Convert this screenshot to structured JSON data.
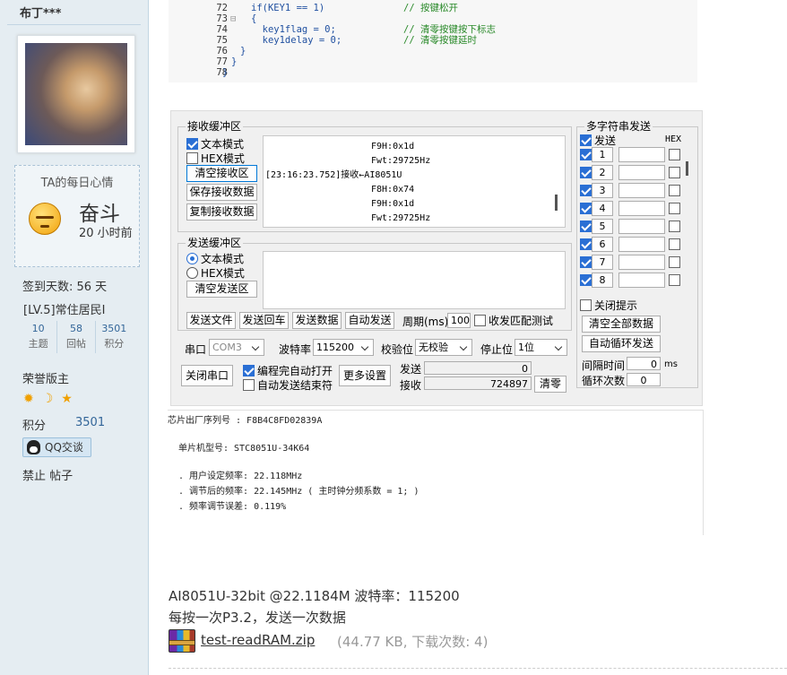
{
  "sidebar": {
    "username": "布丁***",
    "mood_title": "TA的每日心情",
    "mood_word": "奋斗",
    "mood_time": "20 小时前",
    "signin": "签到天数: 56 天",
    "level": "[LV.5]常住居民I",
    "stats": [
      {
        "num": "10",
        "label": "主题"
      },
      {
        "num": "58",
        "label": "回帖"
      },
      {
        "num": "3501",
        "label": "积分"
      }
    ],
    "honor": "荣誉版主",
    "medals": [
      "sun-icon",
      "moon-icon",
      "star-icon"
    ],
    "points_label": "积分",
    "points_value": "3501",
    "qq_button": "QQ交谈",
    "ban_links": "禁止 帖子"
  },
  "code": {
    "lines": [
      {
        "n": "72",
        "fold": "",
        "code": "if(KEY1 == 1)",
        "comment": "// 按键松开"
      },
      {
        "n": "73",
        "fold": "⊟",
        "code": "{",
        "comment": ""
      },
      {
        "n": "74",
        "fold": "",
        "code": "  key1flag = 0;",
        "comment": "// 清零按键按下标志"
      },
      {
        "n": "75",
        "fold": "",
        "code": "  key1delay = 0;",
        "comment": "// 清零按键延时"
      },
      {
        "n": "76",
        "fold": "",
        "code": "}",
        "comment": ""
      },
      {
        "n": "77",
        "fold": "",
        "code": "}",
        "comment": ""
      },
      {
        "n": "78",
        "fold": "",
        "code": "}",
        "comment": ""
      }
    ]
  },
  "serial": {
    "recv_group": "接收缓冲区",
    "recv_text_mode": "文本模式",
    "recv_hex_mode": "HEX模式",
    "clear_recv": "清空接收区",
    "save_recv": "保存接收数据",
    "copy_recv": "复制接收数据",
    "recv_lines": [
      "F9H:0x1d",
      "Fwt:29725Hz",
      "[23:16:23.752]接收←AI8051U",
      "F8H:0x74",
      "F9H:0x1d",
      "Fwt:29725Hz"
    ],
    "send_group": "发送缓冲区",
    "send_text_mode": "文本模式",
    "send_hex_mode": "HEX模式",
    "clear_send": "清空发送区",
    "send_file": "发送文件",
    "send_enter": "发送回车",
    "send_data": "发送数据",
    "auto_send": "自动发送",
    "period_label": "周期(ms)",
    "period_value": "100",
    "match_test": "收发匹配测试",
    "port_label": "串口",
    "port_value": "COM3",
    "baud_label": "波特率",
    "baud_value": "115200",
    "parity_label": "校验位",
    "parity_value": "无校验",
    "stop_label": "停止位",
    "stop_value": "1位",
    "close_port": "关闭串口",
    "auto_open": "编程完自动打开",
    "auto_send_end": "自动发送结束符",
    "more_settings": "更多设置",
    "send_label": "发送",
    "send_count": "0",
    "recv_label": "接收",
    "recv_count": "724897",
    "clear_counts": "清零",
    "multi_group": "多字符串发送",
    "multi_send": "发送",
    "multi_hex": "HEX",
    "multi_rows": [
      "1",
      "2",
      "3",
      "4",
      "5",
      "6",
      "7",
      "8"
    ],
    "close_hint": "关闭提示",
    "clear_all": "清空全部数据",
    "auto_loop": "自动循环发送",
    "interval_label": "间隔时间",
    "interval_value": "0",
    "interval_unit": "ms",
    "loop_label": "循环次数",
    "loop_value": "0"
  },
  "output": {
    "lines": [
      "芯片出厂序列号 : F8B4C8FD02839A",
      "单片机型号: STC8051U-34K64",
      ". 用户设定频率: 22.118MHz",
      ". 调节后的频率: 22.145MHz ( 主时钟分频系数 = 1; )",
      ". 频率调节误差: 0.119%"
    ]
  },
  "post": {
    "line1": "AI8051U-32bit @22.1184M 波特率：115200",
    "line2": "每按一次P3.2，发送一次数据",
    "file_name": "test-readRAM.zip",
    "file_meta": "(44.77 KB, 下载次数: 4)"
  }
}
